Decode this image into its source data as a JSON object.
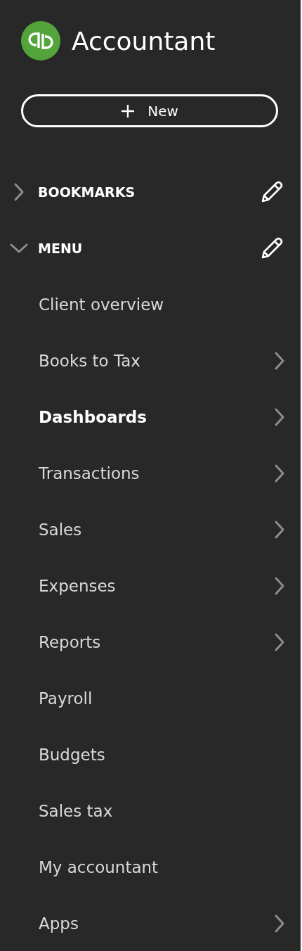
{
  "app": {
    "title": "Accountant"
  },
  "new_button": {
    "label": "New"
  },
  "sections": [
    {
      "label": "BOOKMARKS",
      "expanded": false
    },
    {
      "label": "MENU",
      "expanded": true
    }
  ],
  "menu_items": [
    {
      "label": "Client overview",
      "selected": false,
      "has_submenu": false
    },
    {
      "label": "Books to Tax",
      "selected": false,
      "has_submenu": true
    },
    {
      "label": "Dashboards",
      "selected": true,
      "has_submenu": true
    },
    {
      "label": "Transactions",
      "selected": false,
      "has_submenu": true
    },
    {
      "label": "Sales",
      "selected": false,
      "has_submenu": true
    },
    {
      "label": "Expenses",
      "selected": false,
      "has_submenu": true
    },
    {
      "label": "Reports",
      "selected": false,
      "has_submenu": true
    },
    {
      "label": "Payroll",
      "selected": false,
      "has_submenu": false
    },
    {
      "label": "Budgets",
      "selected": false,
      "has_submenu": false
    },
    {
      "label": "Sales tax",
      "selected": false,
      "has_submenu": false
    },
    {
      "label": "My accountant",
      "selected": false,
      "has_submenu": false
    },
    {
      "label": "Apps",
      "selected": false,
      "has_submenu": true
    }
  ]
}
